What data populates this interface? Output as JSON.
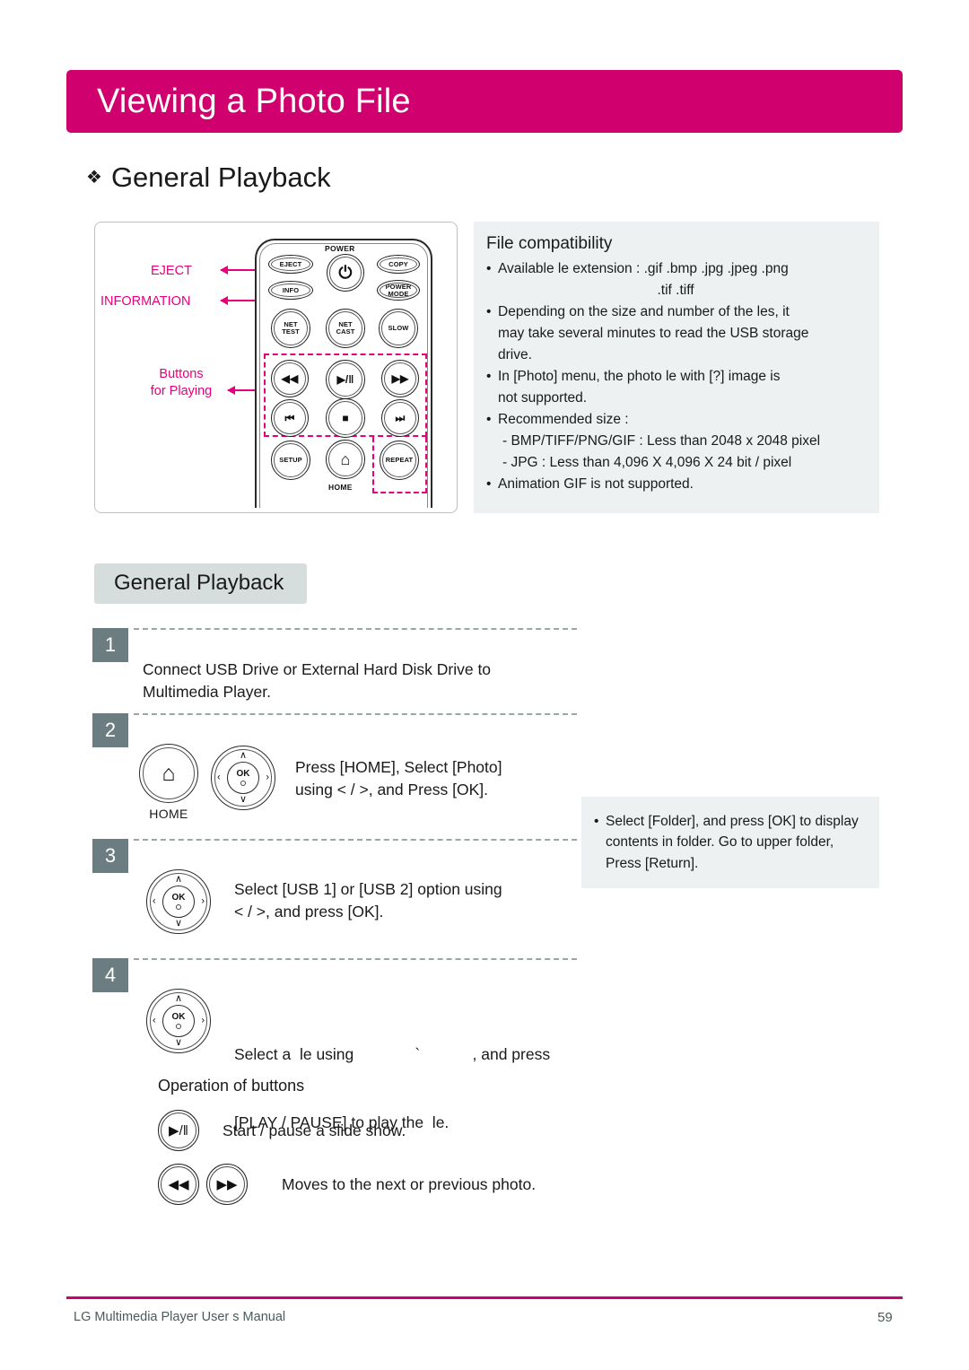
{
  "header": {
    "title": "Viewing a Photo File",
    "accent_color": "#D0006F"
  },
  "section": {
    "bullet_glyph": "❖",
    "title": "General Playback"
  },
  "remote_diagram": {
    "callouts": [
      {
        "label": "EJECT"
      },
      {
        "label": "INFORMATION"
      },
      {
        "label_line1": "Buttons",
        "label_line2": "for Playing"
      }
    ],
    "buttons": {
      "eject": "EJECT",
      "power_label": "POWER",
      "power_glyph": "⏻",
      "copy": "COPY",
      "info": "INFO",
      "power_mode_line1": "POWER",
      "power_mode_line2": "MODE",
      "net_test_line1": "NET",
      "net_test_line2": "TEST",
      "net_cast_line1": "NET",
      "net_cast_line2": "CAST",
      "slow": "SLOW",
      "rewind_glyph": "◀◀",
      "play_pause_glyph": "▶/‖",
      "forward_glyph": "▶▶",
      "prev_glyph": "⏮",
      "stop_glyph": "■",
      "next_glyph": "⏭",
      "setup": "SETUP",
      "home_glyph": "⌂",
      "home_caption": "HOME",
      "repeat": "REPEAT"
    }
  },
  "file_compatibility": {
    "title": "File compatibility",
    "items": [
      "Available  le extension : .gif .bmp .jpg .jpeg .png",
      ".tif .tiff",
      "Depending on the size and number of the  les, it",
      "may take several minutes to read the USB storage",
      "drive.",
      "In [Photo] menu, the photo  le with [?] image is",
      "not supported.",
      "Recommended size :",
      "- BMP/TIFF/PNG/GIF : Less than 2048 x 2048 pixel",
      "- JPG : Less than  4,096 X 4,096 X 24 bit / pixel",
      "Animation GIF is not supported."
    ]
  },
  "playback": {
    "pill_label": "General Playback",
    "steps": [
      {
        "number": "1",
        "line1": "Connect USB Drive or External Hard Disk Drive to",
        "line2": "Multimedia Player."
      },
      {
        "number": "2",
        "home_caption": "HOME",
        "line1": "Press [HOME], Select [Photo]",
        "line2": "using < / >, and Press [OK]."
      },
      {
        "number": "3",
        "line1": "Select [USB 1] or [USB 2] option using",
        "line2": "< / >, and press [OK]."
      },
      {
        "number": "4",
        "line1": "Select a  le using              `            , and press",
        "line2": "[PLAY / PAUSE] to play the  le."
      }
    ]
  },
  "folder_note": {
    "text": "Select [Folder], and press [OK] to display contents in folder. Go to upper folder, Press [Return]."
  },
  "operation": {
    "title": "Operation of buttons",
    "rows": [
      {
        "glyph1": "▶/‖",
        "label": "Start / pause a slide show."
      },
      {
        "glyph1": "◀◀",
        "glyph2": "▶▶",
        "label": "Moves to the next or previous photo."
      }
    ]
  },
  "footer": {
    "left": "LG Multimedia Player User s Manual",
    "page": "59"
  }
}
